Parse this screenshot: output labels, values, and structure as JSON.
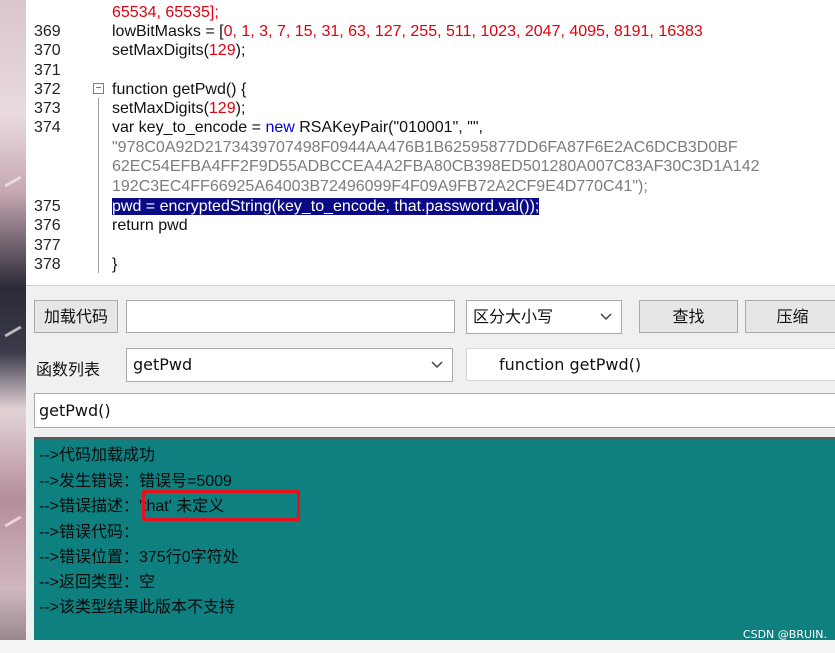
{
  "editor": {
    "lines": [
      {
        "no": "",
        "text": "65534, 65535];"
      },
      {
        "no": "369",
        "pre": "lowBitMasks = [",
        "nums": "0, 1, 3, 7, 15, 31, 63, 127, 255, 511, 1023, 2047, 4095, 8191, 16383"
      },
      {
        "no": "370",
        "pre": "setMaxDigits(",
        "nums": "129",
        "post": ");"
      },
      {
        "no": "371"
      },
      {
        "no": "372",
        "pre": "function getPwd() {"
      },
      {
        "no": "373",
        "pre": "setMaxDigits(",
        "nums": "129",
        "post": ");"
      },
      {
        "no": "374",
        "pre": "var key_to_encode = ",
        "kw": "new",
        "post": " RSAKeyPair(\"010001\", \"\","
      },
      {
        "no": "",
        "str": "\"978C0A92D2173439707498F0944AA476B1B62595877DD6FA87F6E2AC6DCB3D0BF"
      },
      {
        "no": "",
        "str": "62EC54EFBA4FF2F9D55ADBCCEA4A2FBA80CB398ED501280A007C83AF30C3D1A142"
      },
      {
        "no": "",
        "str": "192C3EC4FF66925A64003B72496099F4F09A9FB72A2CF9E4D770C41\");"
      },
      {
        "no": "375",
        "sel": "pwd = encryptedString(key_to_encode, that.password.val());"
      },
      {
        "no": "376",
        "pre": "return pwd"
      },
      {
        "no": "377"
      },
      {
        "no": "378",
        "pre": "}"
      }
    ]
  },
  "toolbar": {
    "load_code_label": "加载代码",
    "load_code_input": "",
    "case_select": "区分大小写",
    "find_label": "查找",
    "compress_label": "压缩"
  },
  "functions": {
    "label": "函数列表",
    "selected": "getPwd",
    "signature": "function getPwd()"
  },
  "call_input": "getPwd()",
  "output": {
    "lines": [
      "-->代码加载成功",
      "-->发生错误：错误号=5009",
      "-->错误描述：'that' 未定义",
      "-->错误代码：",
      "-->错误位置：375行0字符处",
      "-->返回类型：空",
      "-->该类型结果此版本不支持"
    ]
  },
  "footer": {
    "credit": "CSDN @BRUIN."
  },
  "colors": {
    "output_bg": "#0f8080",
    "number": "#e0000e",
    "keyword": "#0000e0",
    "selection": "#0a0a87",
    "highlight_box": "#e8101a"
  }
}
